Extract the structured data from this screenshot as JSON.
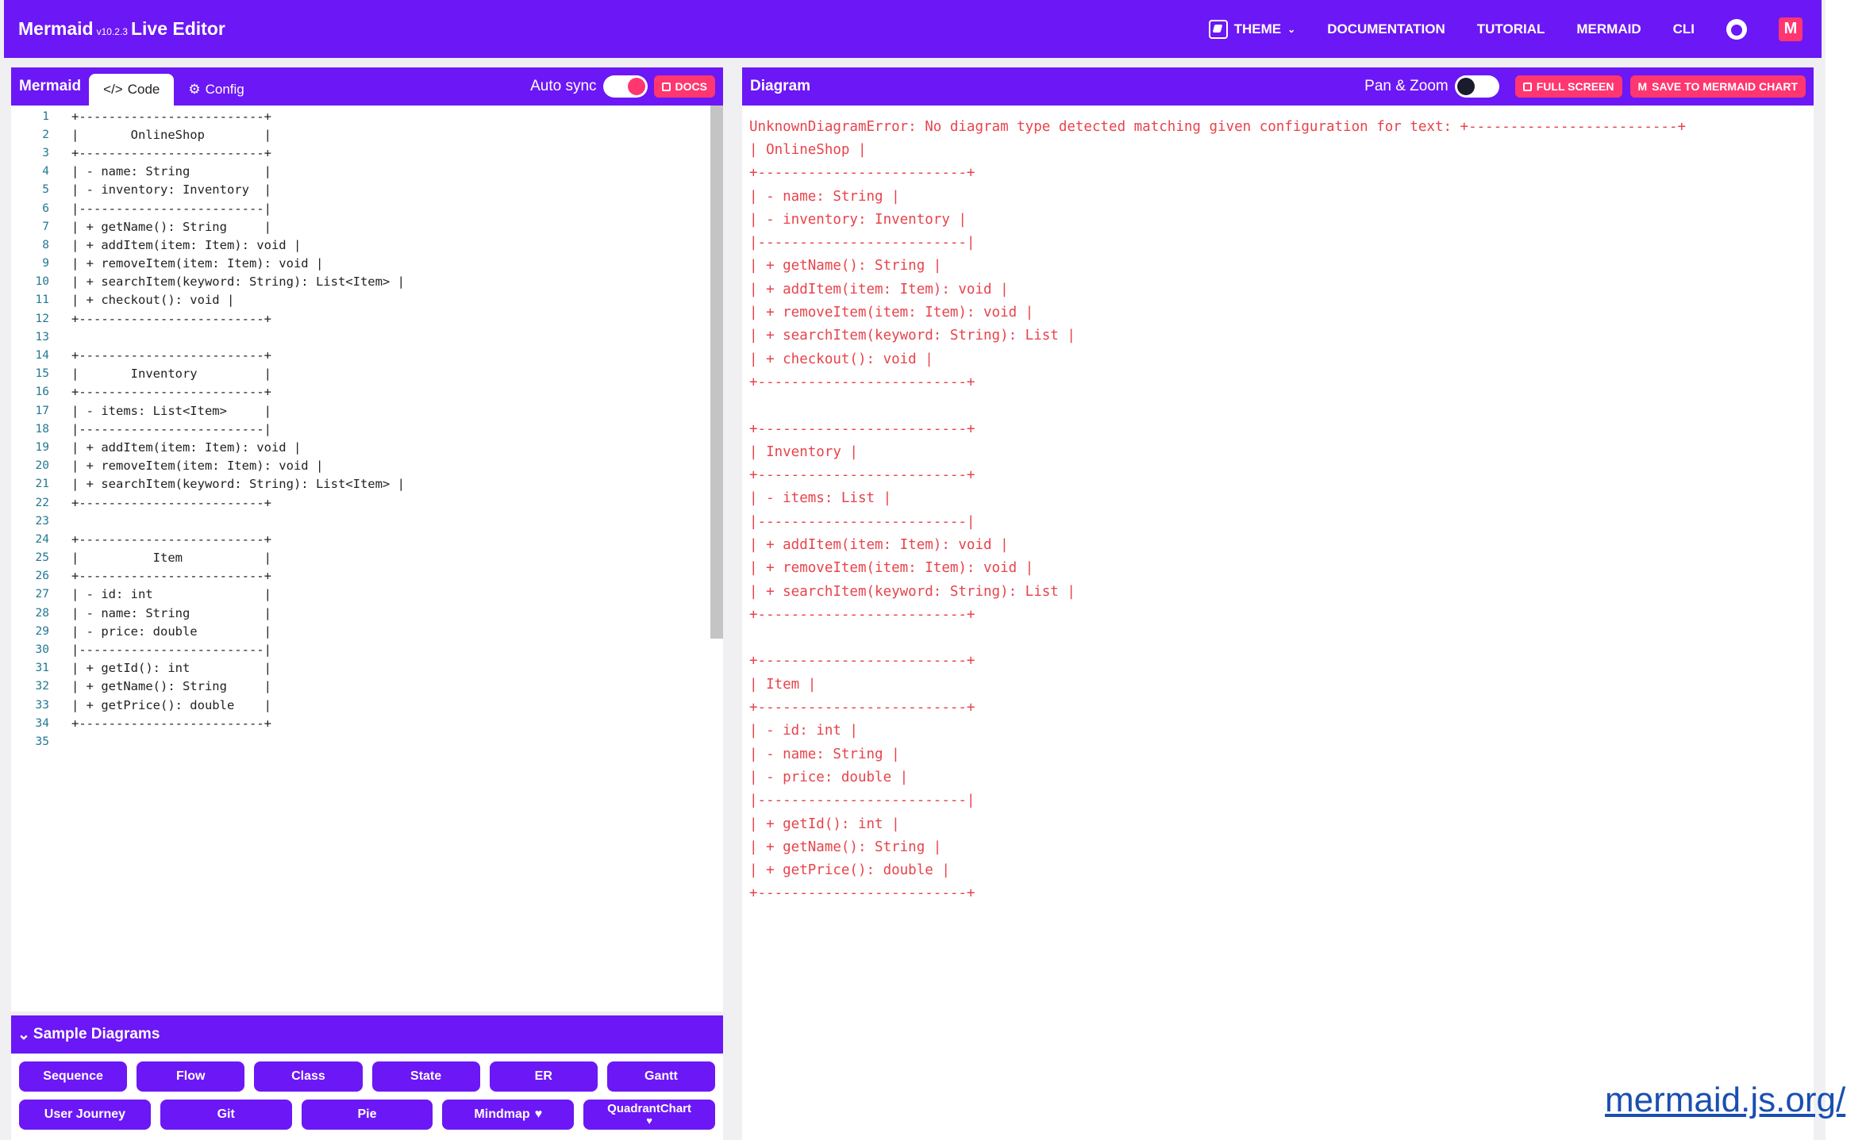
{
  "navbar": {
    "brand": "Mermaid",
    "version": "v10.2.3",
    "brand_suffix": "Live Editor",
    "theme_label": "THEME",
    "links": [
      "DOCUMENTATION",
      "TUTORIAL",
      "MERMAID",
      "CLI"
    ],
    "icons": [
      "theme-icon",
      "github-icon",
      "mermaid-chart-icon"
    ]
  },
  "editor_panel": {
    "title": "Mermaid",
    "tabs": [
      {
        "label": "Code",
        "active": true
      },
      {
        "label": "Config",
        "active": false
      }
    ],
    "auto_sync_label": "Auto sync",
    "auto_sync_on": true,
    "docs_label": "DOCS",
    "lines": [
      "+-------------------------+",
      "|       OnlineShop        |",
      "+-------------------------+",
      "| - name: String          |",
      "| - inventory: Inventory  |",
      "|-------------------------|",
      "| + getName(): String     |",
      "| + addItem(item: Item): void |",
      "| + removeItem(item: Item): void |",
      "| + searchItem(keyword: String): List<Item> |",
      "| + checkout(): void |",
      "+-------------------------+",
      "",
      "+-------------------------+",
      "|       Inventory         |",
      "+-------------------------+",
      "| - items: List<Item>     |",
      "|-------------------------|",
      "| + addItem(item: Item): void |",
      "| + removeItem(item: Item): void |",
      "| + searchItem(keyword: String): List<Item> |",
      "+-------------------------+",
      "",
      "+-------------------------+",
      "|          Item           |",
      "+-------------------------+",
      "| - id: int               |",
      "| - name: String          |",
      "| - price: double         |",
      "|-------------------------|",
      "| + getId(): int          |",
      "| + getName(): String     |",
      "| + getPrice(): double    |",
      "+-------------------------+",
      ""
    ]
  },
  "samples": {
    "title": "Sample Diagrams",
    "row1": [
      "Sequence",
      "Flow",
      "Class",
      "State",
      "ER",
      "Gantt"
    ],
    "row2": [
      "User Journey",
      "Git",
      "Pie",
      "Mindmap",
      "QuadrantChart"
    ]
  },
  "diagram_panel": {
    "title": "Diagram",
    "pan_zoom_label": "Pan & Zoom",
    "pan_zoom_on": false,
    "full_screen_label": "FULL SCREEN",
    "save_label": "SAVE TO MERMAID CHART",
    "error_lines": [
      "UnknownDiagramError: No diagram type detected matching given configuration for text: +-------------------------+",
      "| OnlineShop |",
      "+-------------------------+",
      "| - name: String |",
      "| - inventory: Inventory |",
      "|-------------------------|",
      "| + getName(): String |",
      "| + addItem(item: Item): void |",
      "| + removeItem(item: Item): void |",
      "| + searchItem(keyword: String): List |",
      "| + checkout(): void |",
      "+-------------------------+",
      "",
      "+-------------------------+",
      "| Inventory |",
      "+-------------------------+",
      "| - items: List |",
      "|-------------------------|",
      "| + addItem(item: Item): void |",
      "| + removeItem(item: Item): void |",
      "| + searchItem(keyword: String): List |",
      "+-------------------------+",
      "",
      "+-------------------------+",
      "| Item |",
      "+-------------------------+",
      "| - id: int |",
      "| - name: String |",
      "| - price: double |",
      "|-------------------------|",
      "| + getId(): int |",
      "| + getName(): String |",
      "| + getPrice(): double |",
      "+-------------------------+"
    ]
  },
  "footer_link": "mermaid.js.org/"
}
